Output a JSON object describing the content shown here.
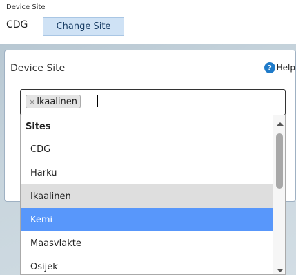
{
  "header": {
    "label": "Device Site",
    "current_site": "CDG",
    "change_button": "Change Site"
  },
  "dialog": {
    "title": "Device Site",
    "help_label": "Help",
    "help_icon": "?",
    "select": {
      "selected_tag": "Ikaalinen",
      "tag_remove": "×"
    },
    "dropdown": {
      "group_label": "Sites",
      "options": [
        "CDG",
        "Harku",
        "Ikaalinen",
        "Kemi",
        "Maasvlakte",
        "Osijek"
      ],
      "hovered": "Ikaalinen",
      "highlighted": "Kemi"
    }
  },
  "colors": {
    "highlight": "#5897fb",
    "hover": "#dedede",
    "button_bg": "#cfe2f5",
    "help_icon": "#1f7bc9"
  }
}
